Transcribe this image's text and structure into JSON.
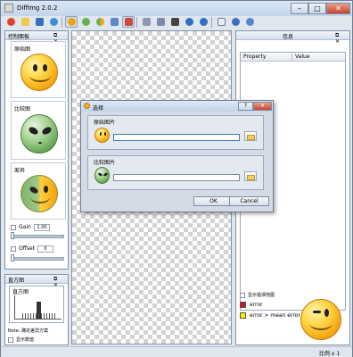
{
  "window": {
    "title": "Diffimg 2.0.2",
    "minimize": "–",
    "maximize": "□",
    "close": "✕"
  },
  "toolbar": {
    "icons": [
      "settings-icon",
      "open-folder-icon",
      "save-icon",
      "refresh-icon",
      "original-view-icon",
      "compare-view-icon",
      "diff-view-icon",
      "split-view-icon",
      "histogram-icon",
      "link-icon",
      "sync-icon",
      "zoom-fit-icon",
      "back-icon",
      "forward-icon",
      "report-icon",
      "help-icon",
      "about-icon"
    ]
  },
  "left_panel": {
    "title": "控制面板",
    "header_buttons": "⧉ ✕",
    "tiles": [
      {
        "label": "原始图",
        "kind": "smiley"
      },
      {
        "label": "比较图",
        "kind": "alien"
      },
      {
        "label": "差异",
        "kind": "diff"
      }
    ],
    "gain_label": "Gain",
    "gain_value": "1.00",
    "offset_label": "Offset",
    "offset_value": "0"
  },
  "histogram_panel": {
    "title": "直方图",
    "header_buttons": "⧉ ✕",
    "inner_title": "直方图",
    "note": "Note: 确定差异方案",
    "option_label": "显示数值"
  },
  "right_panel": {
    "title": "信息",
    "header_buttons": "⧉ ✕",
    "table": {
      "headers": [
        "Property",
        "Value"
      ]
    },
    "show_error_label": "显示错误地图",
    "legend": [
      {
        "color": "#d8111b",
        "text": "error"
      },
      {
        "color": "#ffee00",
        "text": "error > mean error"
      }
    ]
  },
  "dialog": {
    "title": "选择",
    "help": "?",
    "close": "✕",
    "original_group": "原始图片",
    "compare_group": "比较图片",
    "original_path": "",
    "compare_path": "",
    "ok": "OK",
    "cancel": "Cancel"
  },
  "status": {
    "zoom_text": "比例 x 1"
  }
}
